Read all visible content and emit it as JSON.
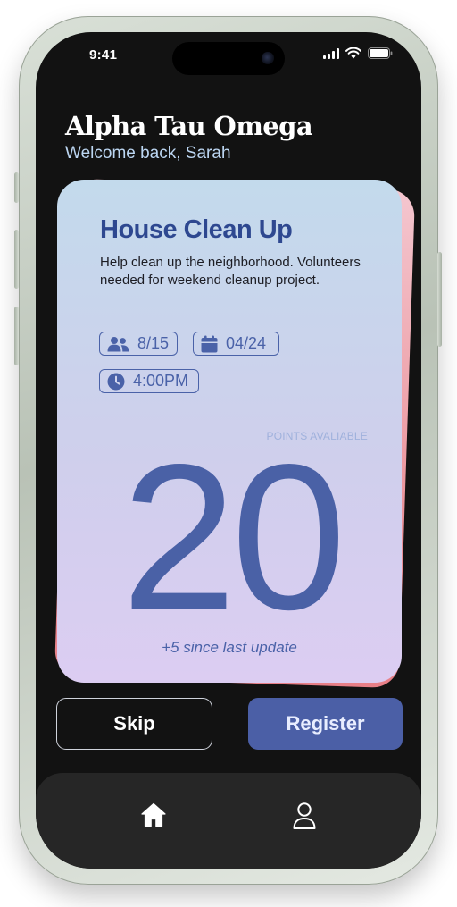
{
  "status_bar": {
    "time": "9:41",
    "icons": [
      "cellular-signal-icon",
      "wifi-icon",
      "battery-icon"
    ]
  },
  "header": {
    "title": "Alpha Tau Omega",
    "subtitle": "Welcome back, Sarah"
  },
  "event_card": {
    "title": "House Clean Up",
    "description": "Help clean up the neighborhood. Volunteers needed for weekend cleanup project.",
    "volunteers": "8/15",
    "date": "04/24",
    "time": "4:00PM",
    "points_label": "POINTS AVALIABLE",
    "points": "20",
    "points_delta": "+5 since last update"
  },
  "actions": {
    "skip_label": "Skip",
    "register_label": "Register"
  },
  "bottom_nav": {
    "items": [
      "home-icon",
      "profile-icon"
    ]
  },
  "colors": {
    "screen_background": "#121212",
    "card_front_top": "#c3daec",
    "card_front_bottom": "#dccdf2",
    "card_back": "#ec9aa2",
    "accent": "#4b5fa6",
    "welcome_text": "#bcd6f2",
    "nav_background": "#262626"
  }
}
